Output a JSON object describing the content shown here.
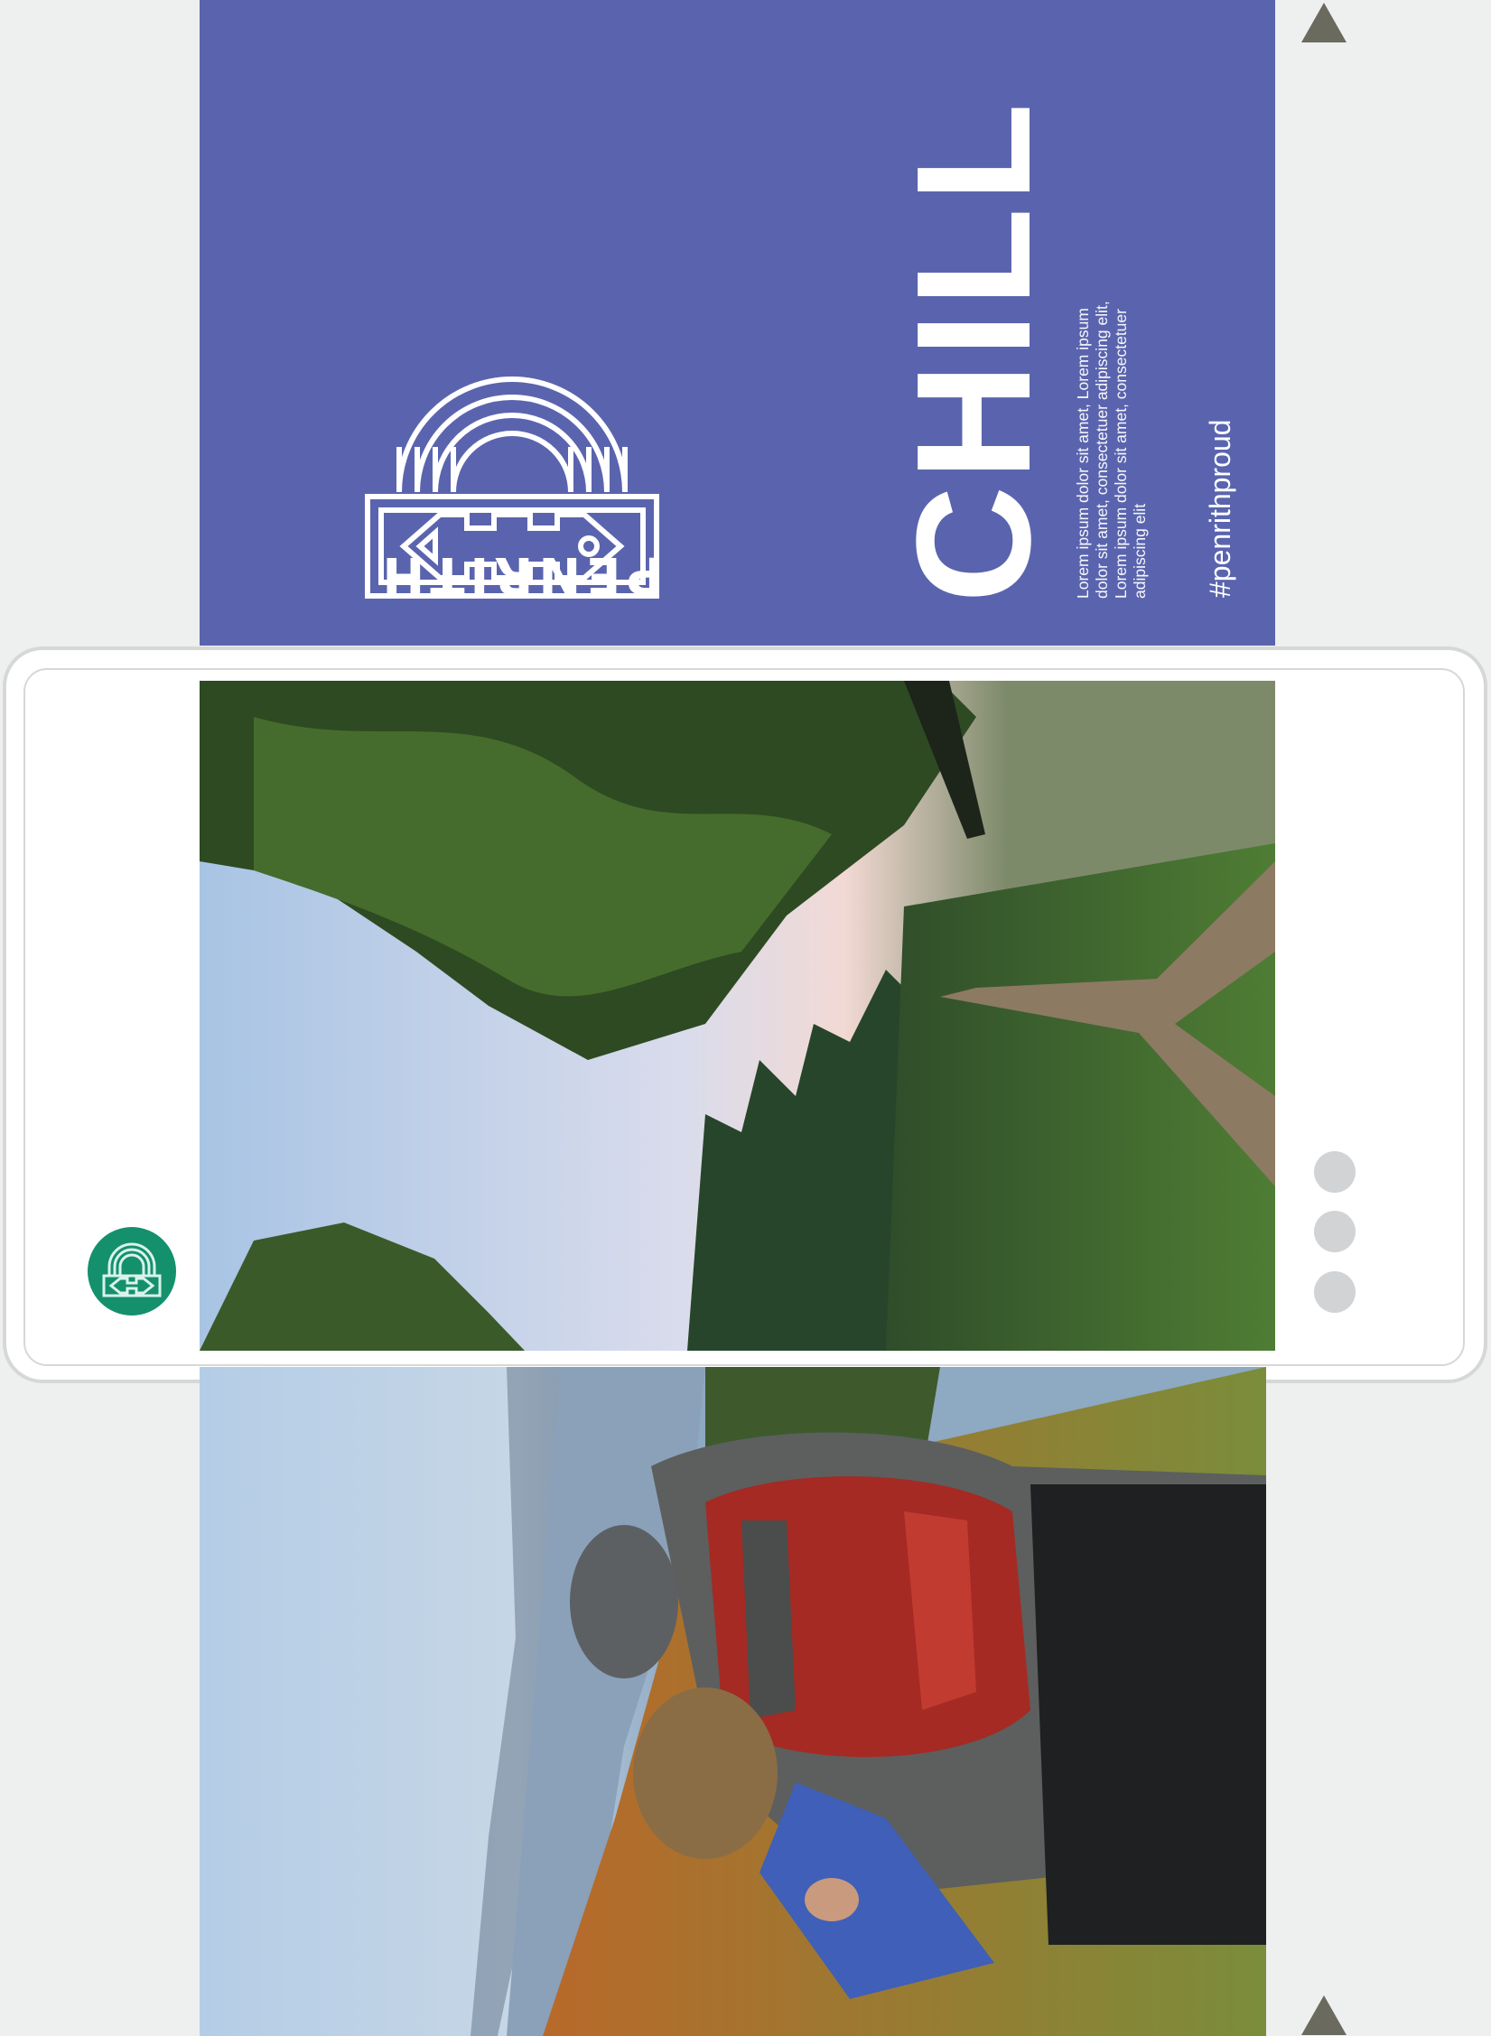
{
  "panel": {
    "brand": "PENRITH",
    "headline": "CHILL",
    "body": "Lorem ipsum dolor sit amet, Lorem ipsum dolor sit amet, consectetuer adipiscing elit, Lorem ipsum dolor sit amet, consectetuer adipiscing elit",
    "hashtag": "#penrithproud",
    "background": "#5a64ae",
    "text_color": "#ffffff"
  },
  "phone": {
    "frame_color": "#d6d8d7",
    "avatar_color": "#14906d",
    "pagination_dots": 3,
    "dot_color": "#d1d3d5"
  },
  "icons": [
    "triangle-up-icon",
    "triangle-up-icon",
    "triangle-up-icon",
    "penrith-logo",
    "avatar-logo"
  ],
  "photos": {
    "woodland": "woodland path with trees at dusk",
    "hikers": "two hikers with red backpack overlooking a lake"
  }
}
